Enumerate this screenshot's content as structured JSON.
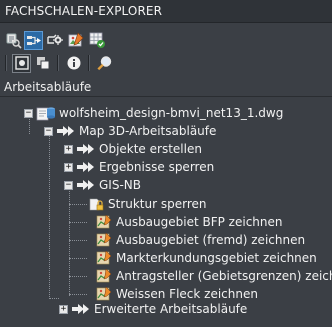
{
  "panel": {
    "title": "FACHSCHALEN-EXPLORER",
    "section_label": "Arbeitsabläufe"
  },
  "toolbar": {
    "row1": [
      {
        "name": "data-connect-icon"
      },
      {
        "name": "workflow-explorer-icon"
      },
      {
        "name": "settings-nodes-icon"
      },
      {
        "name": "map-edit-icon"
      },
      {
        "name": "grid-check-icon"
      }
    ],
    "row2": [
      {
        "name": "record-icon"
      },
      {
        "name": "copy-icon"
      },
      {
        "name": "info-icon"
      },
      {
        "name": "search-icon"
      }
    ]
  },
  "tree": {
    "root_label": "wolfsheim_design-bmvi_net13_1.dwg",
    "group_label": "Map 3D-Arbeitsabläufe",
    "items": [
      {
        "label": "Objekte erstellen",
        "expander": "+"
      },
      {
        "label": "Ergebnisse sperren",
        "expander": "+"
      },
      {
        "label": "GIS-NB",
        "expander": "−"
      }
    ],
    "gis_children": [
      {
        "label": "Struktur sperren",
        "icon": "lock-icon"
      },
      {
        "label": "Ausbaugebiet BFP zeichnen",
        "icon": "draw-map-icon"
      },
      {
        "label": "Ausbaugebiet (fremd) zeichnen",
        "icon": "draw-map-icon"
      },
      {
        "label": "Markterkundungsgebiet zeichnen",
        "icon": "draw-map-icon"
      },
      {
        "label": "Antragsteller (Gebietsgrenzen) zeichnen",
        "icon": "draw-map-icon"
      },
      {
        "label": "Weissen Fleck zeichnen",
        "icon": "draw-map-icon"
      }
    ],
    "last_item": {
      "label": "Erweiterte Arbeitsabläufe",
      "expander": "+"
    }
  }
}
